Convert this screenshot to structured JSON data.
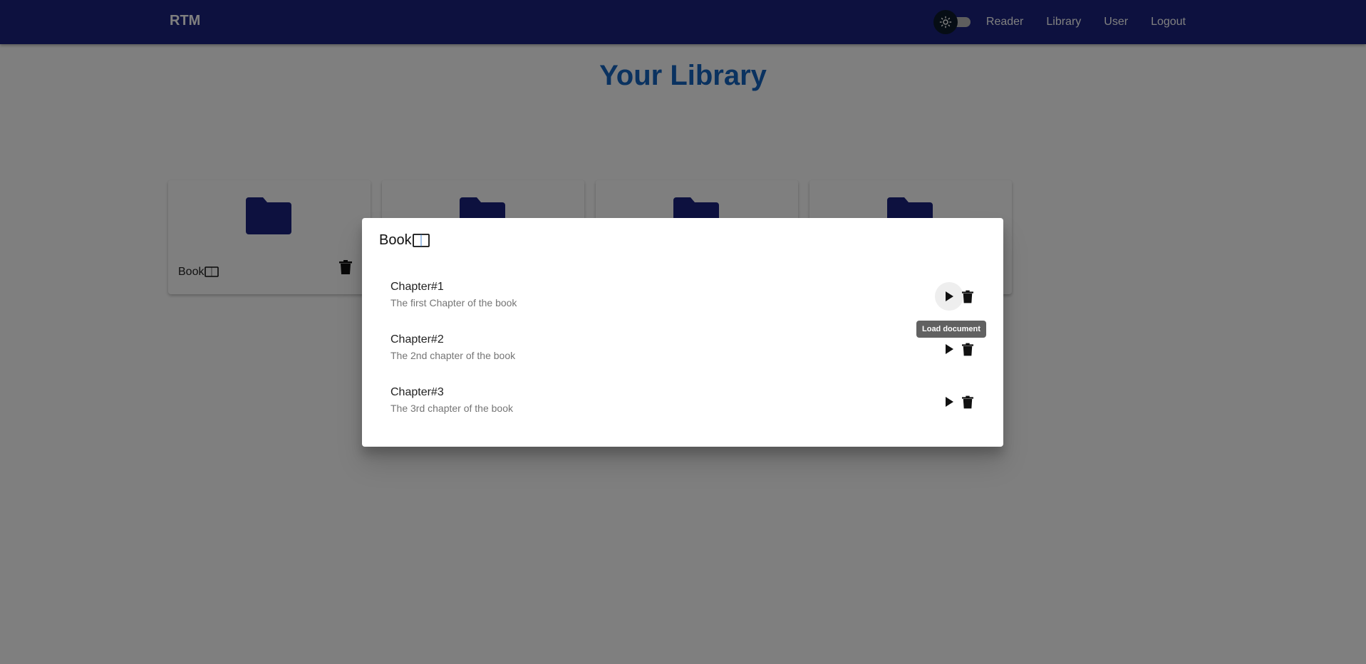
{
  "app": {
    "brand": "RTM",
    "nav": [
      "Reader",
      "Library",
      "User",
      "Logout"
    ],
    "theme_toggle_icon": "sun-icon"
  },
  "page": {
    "title": "Your Library"
  },
  "library": {
    "first_card_label": "Book",
    "card_icon": "folder-icon",
    "card_count": 4
  },
  "dialog": {
    "title": "Book",
    "chapters": [
      {
        "title": "Chapter#1",
        "description": "The first Chapter of the book"
      },
      {
        "title": "Chapter#2",
        "description": "The 2nd chapter of the book"
      },
      {
        "title": "Chapter#3",
        "description": "The 3rd chapter of the book"
      }
    ],
    "tooltip": "Load document"
  },
  "colors": {
    "appbar": "#1a237e",
    "folder": "#1a237e",
    "title": "#1565c0"
  }
}
